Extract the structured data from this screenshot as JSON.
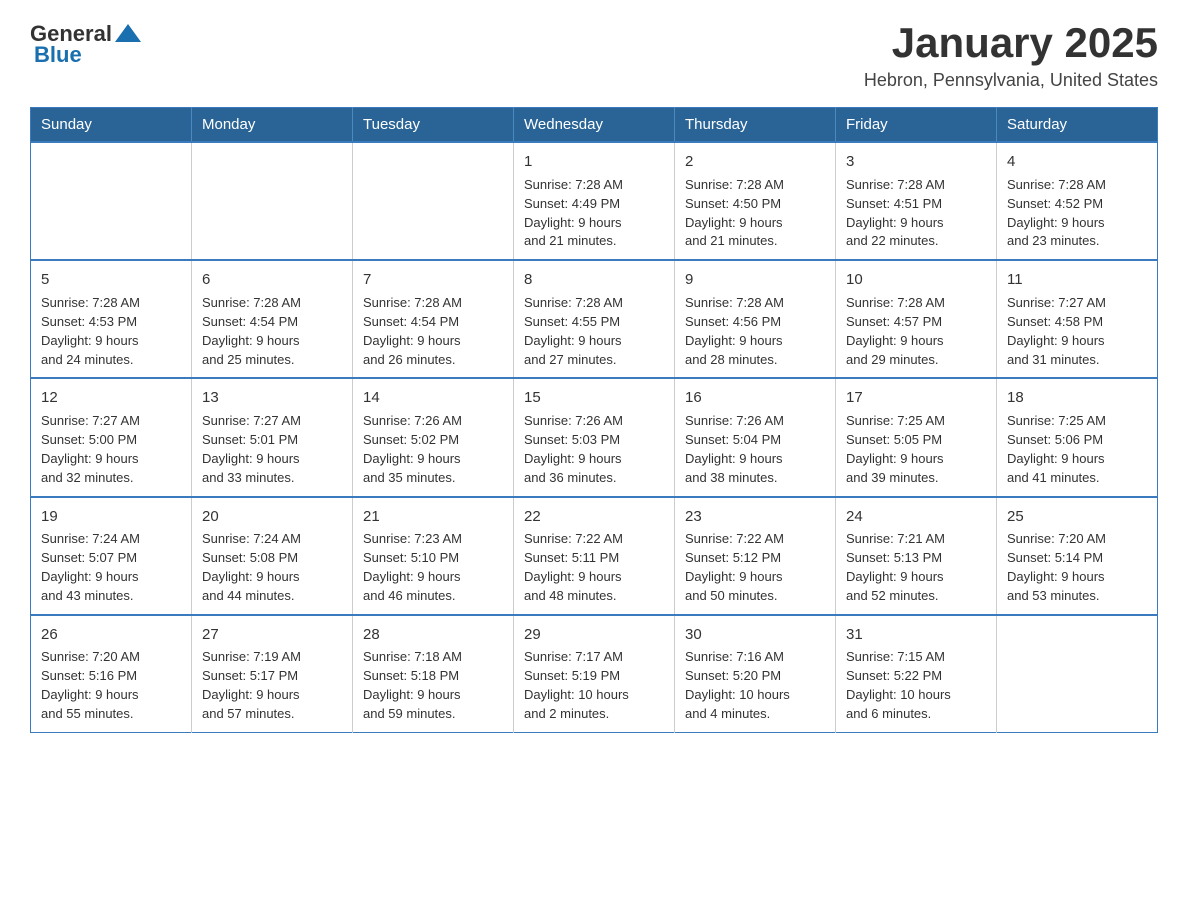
{
  "header": {
    "logo_general": "General",
    "logo_blue": "Blue",
    "title": "January 2025",
    "subtitle": "Hebron, Pennsylvania, United States"
  },
  "columns": [
    "Sunday",
    "Monday",
    "Tuesday",
    "Wednesday",
    "Thursday",
    "Friday",
    "Saturday"
  ],
  "weeks": [
    [
      {
        "day": "",
        "info": ""
      },
      {
        "day": "",
        "info": ""
      },
      {
        "day": "",
        "info": ""
      },
      {
        "day": "1",
        "info": "Sunrise: 7:28 AM\nSunset: 4:49 PM\nDaylight: 9 hours\nand 21 minutes."
      },
      {
        "day": "2",
        "info": "Sunrise: 7:28 AM\nSunset: 4:50 PM\nDaylight: 9 hours\nand 21 minutes."
      },
      {
        "day": "3",
        "info": "Sunrise: 7:28 AM\nSunset: 4:51 PM\nDaylight: 9 hours\nand 22 minutes."
      },
      {
        "day": "4",
        "info": "Sunrise: 7:28 AM\nSunset: 4:52 PM\nDaylight: 9 hours\nand 23 minutes."
      }
    ],
    [
      {
        "day": "5",
        "info": "Sunrise: 7:28 AM\nSunset: 4:53 PM\nDaylight: 9 hours\nand 24 minutes."
      },
      {
        "day": "6",
        "info": "Sunrise: 7:28 AM\nSunset: 4:54 PM\nDaylight: 9 hours\nand 25 minutes."
      },
      {
        "day": "7",
        "info": "Sunrise: 7:28 AM\nSunset: 4:54 PM\nDaylight: 9 hours\nand 26 minutes."
      },
      {
        "day": "8",
        "info": "Sunrise: 7:28 AM\nSunset: 4:55 PM\nDaylight: 9 hours\nand 27 minutes."
      },
      {
        "day": "9",
        "info": "Sunrise: 7:28 AM\nSunset: 4:56 PM\nDaylight: 9 hours\nand 28 minutes."
      },
      {
        "day": "10",
        "info": "Sunrise: 7:28 AM\nSunset: 4:57 PM\nDaylight: 9 hours\nand 29 minutes."
      },
      {
        "day": "11",
        "info": "Sunrise: 7:27 AM\nSunset: 4:58 PM\nDaylight: 9 hours\nand 31 minutes."
      }
    ],
    [
      {
        "day": "12",
        "info": "Sunrise: 7:27 AM\nSunset: 5:00 PM\nDaylight: 9 hours\nand 32 minutes."
      },
      {
        "day": "13",
        "info": "Sunrise: 7:27 AM\nSunset: 5:01 PM\nDaylight: 9 hours\nand 33 minutes."
      },
      {
        "day": "14",
        "info": "Sunrise: 7:26 AM\nSunset: 5:02 PM\nDaylight: 9 hours\nand 35 minutes."
      },
      {
        "day": "15",
        "info": "Sunrise: 7:26 AM\nSunset: 5:03 PM\nDaylight: 9 hours\nand 36 minutes."
      },
      {
        "day": "16",
        "info": "Sunrise: 7:26 AM\nSunset: 5:04 PM\nDaylight: 9 hours\nand 38 minutes."
      },
      {
        "day": "17",
        "info": "Sunrise: 7:25 AM\nSunset: 5:05 PM\nDaylight: 9 hours\nand 39 minutes."
      },
      {
        "day": "18",
        "info": "Sunrise: 7:25 AM\nSunset: 5:06 PM\nDaylight: 9 hours\nand 41 minutes."
      }
    ],
    [
      {
        "day": "19",
        "info": "Sunrise: 7:24 AM\nSunset: 5:07 PM\nDaylight: 9 hours\nand 43 minutes."
      },
      {
        "day": "20",
        "info": "Sunrise: 7:24 AM\nSunset: 5:08 PM\nDaylight: 9 hours\nand 44 minutes."
      },
      {
        "day": "21",
        "info": "Sunrise: 7:23 AM\nSunset: 5:10 PM\nDaylight: 9 hours\nand 46 minutes."
      },
      {
        "day": "22",
        "info": "Sunrise: 7:22 AM\nSunset: 5:11 PM\nDaylight: 9 hours\nand 48 minutes."
      },
      {
        "day": "23",
        "info": "Sunrise: 7:22 AM\nSunset: 5:12 PM\nDaylight: 9 hours\nand 50 minutes."
      },
      {
        "day": "24",
        "info": "Sunrise: 7:21 AM\nSunset: 5:13 PM\nDaylight: 9 hours\nand 52 minutes."
      },
      {
        "day": "25",
        "info": "Sunrise: 7:20 AM\nSunset: 5:14 PM\nDaylight: 9 hours\nand 53 minutes."
      }
    ],
    [
      {
        "day": "26",
        "info": "Sunrise: 7:20 AM\nSunset: 5:16 PM\nDaylight: 9 hours\nand 55 minutes."
      },
      {
        "day": "27",
        "info": "Sunrise: 7:19 AM\nSunset: 5:17 PM\nDaylight: 9 hours\nand 57 minutes."
      },
      {
        "day": "28",
        "info": "Sunrise: 7:18 AM\nSunset: 5:18 PM\nDaylight: 9 hours\nand 59 minutes."
      },
      {
        "day": "29",
        "info": "Sunrise: 7:17 AM\nSunset: 5:19 PM\nDaylight: 10 hours\nand 2 minutes."
      },
      {
        "day": "30",
        "info": "Sunrise: 7:16 AM\nSunset: 5:20 PM\nDaylight: 10 hours\nand 4 minutes."
      },
      {
        "day": "31",
        "info": "Sunrise: 7:15 AM\nSunset: 5:22 PM\nDaylight: 10 hours\nand 6 minutes."
      },
      {
        "day": "",
        "info": ""
      }
    ]
  ]
}
